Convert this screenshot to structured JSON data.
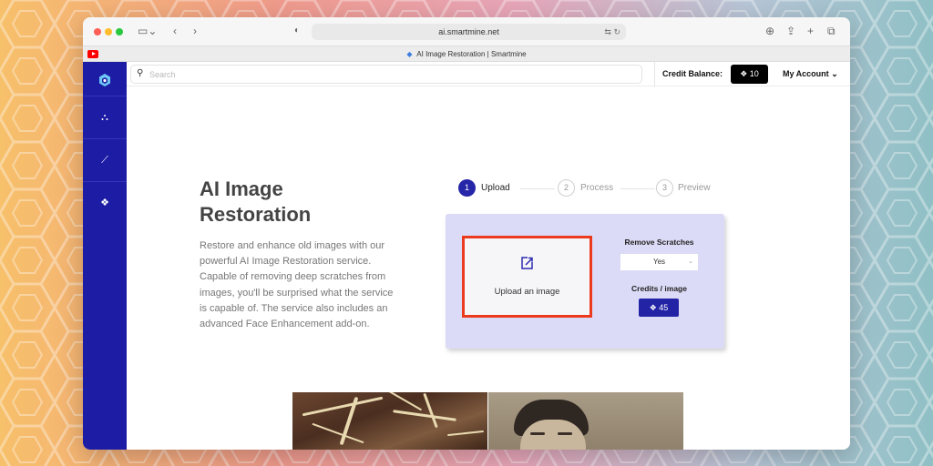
{
  "browser": {
    "url": "ai.smartmine.net",
    "tab_title": "AI Image Restoration | Smartmine"
  },
  "topbar": {
    "search_placeholder": "Search",
    "credit_label": "Credit Balance:",
    "credit_value": "10",
    "account_label": "My Account"
  },
  "hero": {
    "title": "AI Image Restoration",
    "description": "Restore and enhance old images with our powerful AI Image Restoration service. Capable of removing deep scratches from images, you'll be surprised what the service is capable of. The service also includes an advanced Face Enhancement add-on."
  },
  "steps": [
    {
      "num": "1",
      "label": "Upload",
      "active": true
    },
    {
      "num": "2",
      "label": "Process",
      "active": false
    },
    {
      "num": "3",
      "label": "Preview",
      "active": false
    }
  ],
  "upload": {
    "label": "Upload an image",
    "remove_scratches_label": "Remove Scratches",
    "remove_scratches_value": "Yes",
    "credits_label": "Credits / image",
    "credits_value": "45"
  },
  "sidebar": {
    "icons": [
      "logo-icon",
      "network-icon",
      "chart-icon",
      "credits-icon"
    ]
  },
  "colors": {
    "sidebar": "#1c1ca4",
    "accent": "#2626a8",
    "card_bg": "#dcdbf7",
    "highlight_border": "#ec3a1e"
  }
}
